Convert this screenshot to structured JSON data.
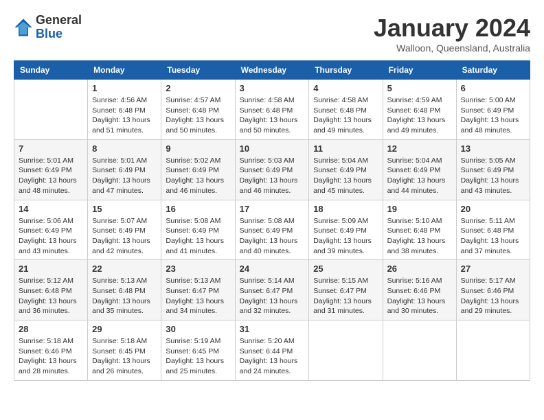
{
  "header": {
    "logo": {
      "general": "General",
      "blue": "Blue"
    },
    "title": "January 2024",
    "subtitle": "Walloon, Queensland, Australia"
  },
  "calendar": {
    "days_of_week": [
      "Sunday",
      "Monday",
      "Tuesday",
      "Wednesday",
      "Thursday",
      "Friday",
      "Saturday"
    ],
    "weeks": [
      [
        {
          "day": "",
          "info": ""
        },
        {
          "day": "1",
          "info": "Sunrise: 4:56 AM\nSunset: 6:48 PM\nDaylight: 13 hours\nand 51 minutes."
        },
        {
          "day": "2",
          "info": "Sunrise: 4:57 AM\nSunset: 6:48 PM\nDaylight: 13 hours\nand 50 minutes."
        },
        {
          "day": "3",
          "info": "Sunrise: 4:58 AM\nSunset: 6:48 PM\nDaylight: 13 hours\nand 50 minutes."
        },
        {
          "day": "4",
          "info": "Sunrise: 4:58 AM\nSunset: 6:48 PM\nDaylight: 13 hours\nand 49 minutes."
        },
        {
          "day": "5",
          "info": "Sunrise: 4:59 AM\nSunset: 6:48 PM\nDaylight: 13 hours\nand 49 minutes."
        },
        {
          "day": "6",
          "info": "Sunrise: 5:00 AM\nSunset: 6:49 PM\nDaylight: 13 hours\nand 48 minutes."
        }
      ],
      [
        {
          "day": "7",
          "info": "Sunrise: 5:01 AM\nSunset: 6:49 PM\nDaylight: 13 hours\nand 48 minutes."
        },
        {
          "day": "8",
          "info": "Sunrise: 5:01 AM\nSunset: 6:49 PM\nDaylight: 13 hours\nand 47 minutes."
        },
        {
          "day": "9",
          "info": "Sunrise: 5:02 AM\nSunset: 6:49 PM\nDaylight: 13 hours\nand 46 minutes."
        },
        {
          "day": "10",
          "info": "Sunrise: 5:03 AM\nSunset: 6:49 PM\nDaylight: 13 hours\nand 46 minutes."
        },
        {
          "day": "11",
          "info": "Sunrise: 5:04 AM\nSunset: 6:49 PM\nDaylight: 13 hours\nand 45 minutes."
        },
        {
          "day": "12",
          "info": "Sunrise: 5:04 AM\nSunset: 6:49 PM\nDaylight: 13 hours\nand 44 minutes."
        },
        {
          "day": "13",
          "info": "Sunrise: 5:05 AM\nSunset: 6:49 PM\nDaylight: 13 hours\nand 43 minutes."
        }
      ],
      [
        {
          "day": "14",
          "info": "Sunrise: 5:06 AM\nSunset: 6:49 PM\nDaylight: 13 hours\nand 43 minutes."
        },
        {
          "day": "15",
          "info": "Sunrise: 5:07 AM\nSunset: 6:49 PM\nDaylight: 13 hours\nand 42 minutes."
        },
        {
          "day": "16",
          "info": "Sunrise: 5:08 AM\nSunset: 6:49 PM\nDaylight: 13 hours\nand 41 minutes."
        },
        {
          "day": "17",
          "info": "Sunrise: 5:08 AM\nSunset: 6:49 PM\nDaylight: 13 hours\nand 40 minutes."
        },
        {
          "day": "18",
          "info": "Sunrise: 5:09 AM\nSunset: 6:49 PM\nDaylight: 13 hours\nand 39 minutes."
        },
        {
          "day": "19",
          "info": "Sunrise: 5:10 AM\nSunset: 6:48 PM\nDaylight: 13 hours\nand 38 minutes."
        },
        {
          "day": "20",
          "info": "Sunrise: 5:11 AM\nSunset: 6:48 PM\nDaylight: 13 hours\nand 37 minutes."
        }
      ],
      [
        {
          "day": "21",
          "info": "Sunrise: 5:12 AM\nSunset: 6:48 PM\nDaylight: 13 hours\nand 36 minutes."
        },
        {
          "day": "22",
          "info": "Sunrise: 5:13 AM\nSunset: 6:48 PM\nDaylight: 13 hours\nand 35 minutes."
        },
        {
          "day": "23",
          "info": "Sunrise: 5:13 AM\nSunset: 6:47 PM\nDaylight: 13 hours\nand 34 minutes."
        },
        {
          "day": "24",
          "info": "Sunrise: 5:14 AM\nSunset: 6:47 PM\nDaylight: 13 hours\nand 32 minutes."
        },
        {
          "day": "25",
          "info": "Sunrise: 5:15 AM\nSunset: 6:47 PM\nDaylight: 13 hours\nand 31 minutes."
        },
        {
          "day": "26",
          "info": "Sunrise: 5:16 AM\nSunset: 6:46 PM\nDaylight: 13 hours\nand 30 minutes."
        },
        {
          "day": "27",
          "info": "Sunrise: 5:17 AM\nSunset: 6:46 PM\nDaylight: 13 hours\nand 29 minutes."
        }
      ],
      [
        {
          "day": "28",
          "info": "Sunrise: 5:18 AM\nSunset: 6:46 PM\nDaylight: 13 hours\nand 28 minutes."
        },
        {
          "day": "29",
          "info": "Sunrise: 5:18 AM\nSunset: 6:45 PM\nDaylight: 13 hours\nand 26 minutes."
        },
        {
          "day": "30",
          "info": "Sunrise: 5:19 AM\nSunset: 6:45 PM\nDaylight: 13 hours\nand 25 minutes."
        },
        {
          "day": "31",
          "info": "Sunrise: 5:20 AM\nSunset: 6:44 PM\nDaylight: 13 hours\nand 24 minutes."
        },
        {
          "day": "",
          "info": ""
        },
        {
          "day": "",
          "info": ""
        },
        {
          "day": "",
          "info": ""
        }
      ]
    ]
  }
}
